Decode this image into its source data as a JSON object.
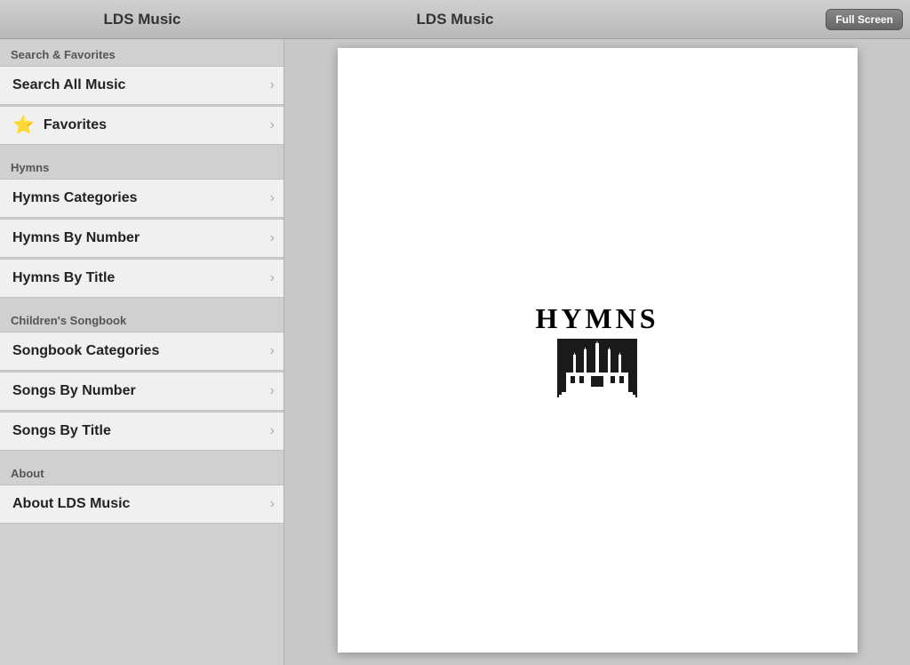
{
  "titleBar": {
    "leftTitle": "LDS Music",
    "centerTitle": "LDS Music",
    "fullscreenLabel": "Full Screen"
  },
  "sidebar": {
    "sections": [
      {
        "id": "search-favorites",
        "header": "Search & Favorites",
        "items": [
          {
            "id": "search-all-music",
            "label": "Search All Music",
            "icon": null,
            "hasChevron": true
          },
          {
            "id": "favorites",
            "label": "Favorites",
            "icon": "⭐",
            "hasChevron": true
          }
        ]
      },
      {
        "id": "hymns",
        "header": "Hymns",
        "items": [
          {
            "id": "hymns-categories",
            "label": "Hymns Categories",
            "icon": null,
            "hasChevron": true
          },
          {
            "id": "hymns-by-number",
            "label": "Hymns By Number",
            "icon": null,
            "hasChevron": true
          },
          {
            "id": "hymns-by-title",
            "label": "Hymns By Title",
            "icon": null,
            "hasChevron": true
          }
        ]
      },
      {
        "id": "childrens-songbook",
        "header": "Children's Songbook",
        "items": [
          {
            "id": "songbook-categories",
            "label": "Songbook Categories",
            "icon": null,
            "hasChevron": true
          },
          {
            "id": "songs-by-number",
            "label": "Songs By Number",
            "icon": null,
            "hasChevron": true
          },
          {
            "id": "songs-by-title",
            "label": "Songs By Title",
            "icon": null,
            "hasChevron": true
          }
        ]
      },
      {
        "id": "about",
        "header": "About",
        "items": [
          {
            "id": "about-lds-music",
            "label": "About LDS Music",
            "icon": null,
            "hasChevron": true
          }
        ]
      }
    ]
  },
  "content": {
    "hymnsTitle": "HYMNS"
  }
}
